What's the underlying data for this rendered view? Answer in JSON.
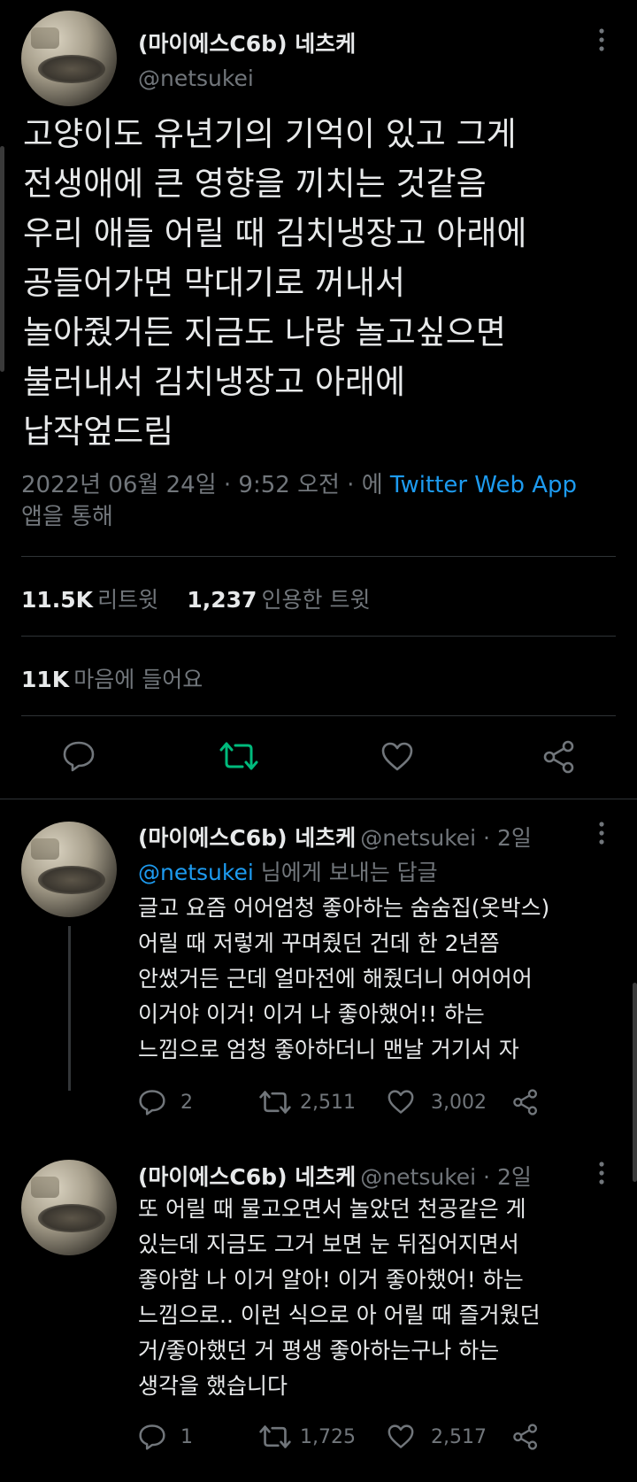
{
  "tweet": {
    "display_name": "(마이에스C6b) 네츠케",
    "handle": "@netsukei",
    "lines": [
      "고양이도 유년기의 기억이 있고 그게",
      "전생애에 큰 영향을 끼치는 것같음",
      "우리 애들 어릴 때 김치냉장고 아래에",
      "공들어가면 막대기로 꺼내서",
      "놀아줬거든 지금도 나랑 놀고싶으면",
      "불러내서 김치냉장고 아래에",
      "납작엎드림"
    ],
    "timestamp": "2022년 06월 24일 · 9:52 오전 · 에",
    "source": "Twitter Web App",
    "source_suffix": "앱을 통해",
    "retweets_num": "11.5K",
    "retweets_label": "리트윗",
    "quotes_num": "1,237",
    "quotes_label": "인용한 트윗",
    "likes_num": "11K",
    "likes_label": "마음에 들어요"
  },
  "replies": [
    {
      "display_name": "(마이에스C6b) 네츠케",
      "handle_time": "@netsukei · 2일",
      "replying_to_handle": "@netsukei",
      "replying_to_suffix": " 님에게 보내는 답글",
      "lines": [
        "글고 요즘 어어엄청 좋아하는 숨숨집(옷박스)",
        "어릴 때 저렇게 꾸며줬던 건데 한 2년쯤",
        "안썼거든 근데 얼마전에 해줬더니 어어어어",
        "이거야 이거! 이거 나 좋아했어!! 하는",
        "느낌으로 엄청 좋아하더니 맨날 거기서 자"
      ],
      "reply_count": "2",
      "retweet_count": "2,511",
      "like_count": "3,002"
    },
    {
      "display_name": "(마이에스C6b) 네츠케",
      "handle_time": "@netsukei · 2일",
      "lines": [
        "또 어릴 때 물고오면서 놀았던 천공같은 게",
        "있는데 지금도 그거 보면 눈 뒤집어지면서",
        "좋아함 나 이거 알아! 이거 좋아했어! 하는",
        "느낌으로.. 이런 식으로 아 어릴 때 즐거웠던",
        "거/좋아했던 거 평생 좋아하는구나 하는",
        "생각을 했습니다"
      ],
      "reply_count": "1",
      "retweet_count": "1,725",
      "like_count": "2,517"
    }
  ],
  "icons": {
    "reply": "reply-icon",
    "retweet": "retweet-icon",
    "like": "heart-icon",
    "share": "share-icon",
    "more": "more-options-icon"
  },
  "colors": {
    "background": "#000000",
    "text": "#e7e9ea",
    "secondary": "#71767b",
    "link": "#1d9bf0",
    "retweet_active": "#00ba7c",
    "divider": "#2f3336"
  }
}
